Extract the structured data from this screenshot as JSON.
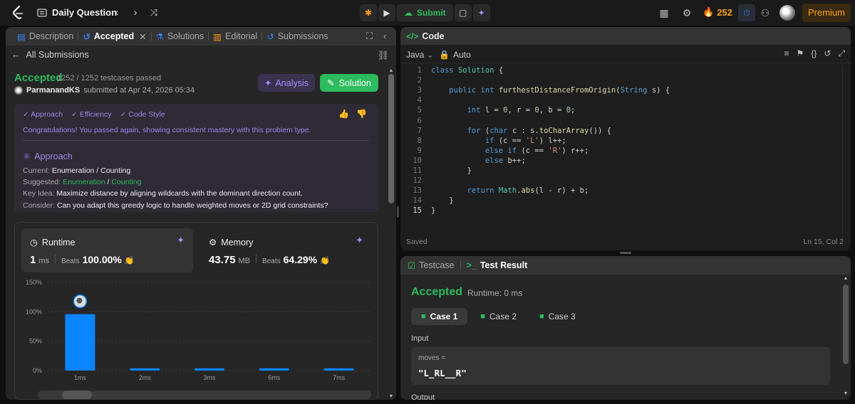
{
  "topbar": {
    "title": "Daily Question",
    "submit_label": "Submit",
    "streak": "252",
    "premium_label": "Premium"
  },
  "tabs": [
    {
      "label": "Description",
      "icon": "document-icon"
    },
    {
      "label": "Accepted",
      "icon": "history-icon"
    },
    {
      "label": "Solutions",
      "icon": "flask-icon"
    },
    {
      "label": "Editorial",
      "icon": "book-icon"
    },
    {
      "label": "Submissions",
      "icon": "history-icon"
    }
  ],
  "submission": {
    "back_label": "All Submissions",
    "status": "Accepted",
    "tests_passed": "1252 / 1252 testcases passed",
    "user": "ParmanandKS",
    "submitted_at": "submitted at Apr 24, 2026 05:34",
    "analysis_label": "Analysis",
    "solution_label": "Solution"
  },
  "feedback": {
    "tags": [
      "Approach",
      "Efficiency",
      "Code Style"
    ],
    "message": "Congratulations! You passed again, showing consistent mastery with this problem type.",
    "approach_title": "Approach",
    "current_label": "Current:",
    "current_value": "Enumeration  /  Counting",
    "suggested_label": "Suggested:",
    "suggested_a": "Enumeration",
    "suggested_sep": "/",
    "suggested_b": "Counting",
    "keyidea_label": "Key Idea:",
    "keyidea_value": "Maximize distance by aligning wildcards with the dominant direction count.",
    "consider_label": "Consider:",
    "consider_value": "Can you adapt this greedy logic to handle weighted moves or 2D grid constraints?"
  },
  "performance": {
    "runtime": {
      "title": "Runtime",
      "value": "1",
      "unit": "ms",
      "beats_label": "Beats",
      "beats": "100.00%"
    },
    "memory": {
      "title": "Memory",
      "value": "43.75",
      "unit": "MB",
      "beats_label": "Beats",
      "beats": "64.29%"
    }
  },
  "chart_data": {
    "type": "bar",
    "categories": [
      "1ms",
      "2ms",
      "3ms",
      "6ms",
      "7ms"
    ],
    "values": [
      96,
      4,
      4,
      4,
      4
    ],
    "yticks": [
      "0%",
      "50%",
      "100%",
      "150%"
    ],
    "ylim": [
      0,
      150
    ],
    "highlight_index": 0,
    "bar_color": "#0a84ff"
  },
  "code": {
    "header": "Code",
    "language": "Java",
    "mode": "Auto",
    "lines": [
      "class Solution {",
      "",
      "    public int furthestDistanceFromOrigin(String s) {",
      "",
      "        int l = 0, r = 0, b = 0;",
      "",
      "        for (char c : s.toCharArray()) {",
      "            if (c == 'L') l++;",
      "            else if (c == 'R') r++;",
      "            else b++;",
      "        }",
      "",
      "        return Math.abs(l - r) + b;",
      "    }",
      "}"
    ],
    "saved_label": "Saved",
    "cursor": "Ln 15, Col 2"
  },
  "test": {
    "tab_testcase": "Testcase",
    "tab_result": "Test Result",
    "status": "Accepted",
    "runtime": "Runtime: 0 ms",
    "cases": [
      "Case 1",
      "Case 2",
      "Case 3"
    ],
    "input_label": "Input",
    "var_name": "moves =",
    "var_value": "\"L_RL__R\"",
    "output_label": "Output"
  }
}
